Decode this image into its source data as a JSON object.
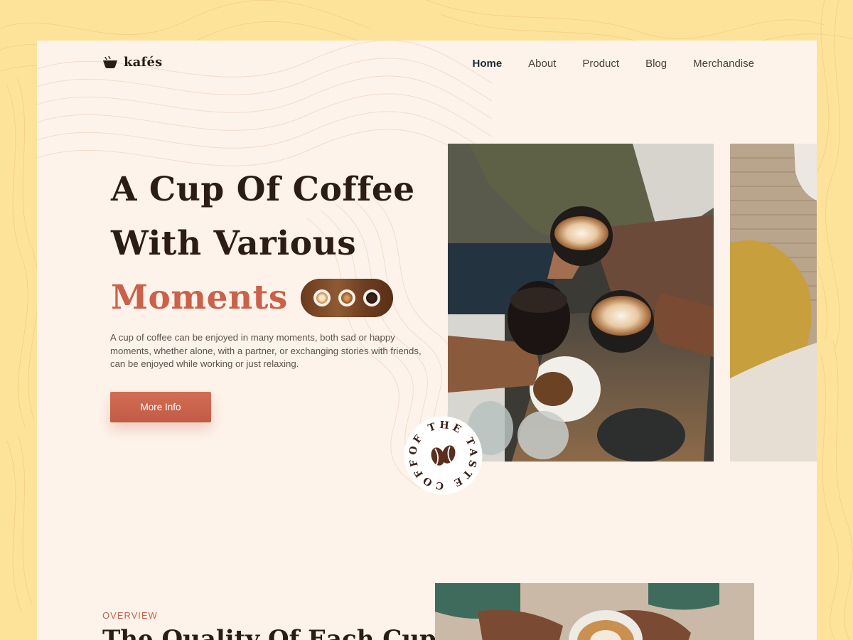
{
  "brand": {
    "name": "kafés",
    "logo_icon": "coffee-cup-icon"
  },
  "nav": {
    "items": [
      {
        "label": "Home",
        "active": true
      },
      {
        "label": "About",
        "active": false
      },
      {
        "label": "Product",
        "active": false
      },
      {
        "label": "Blog",
        "active": false
      },
      {
        "label": "Merchandise",
        "active": false
      }
    ]
  },
  "hero": {
    "line1": "A Cup Of Coffee",
    "line2": "With Various",
    "line3": "Moments",
    "description": "A cup of coffee can be enjoyed in many moments, both sad or happy moments, whether alone, with a partner, or exchanging stories with friends, can be enjoyed while working or just relaxing.",
    "button_label": "More Info"
  },
  "badge": {
    "circular_text": "OF THE TASTE COFFEE",
    "icon": "coffee-bean-icon"
  },
  "overview": {
    "label": "OVERVIEW",
    "title": "The Quality Of Each Cup"
  },
  "colors": {
    "background": "#fde39a",
    "card": "#fef3ea",
    "accent": "#c9614b",
    "heading": "#2b1d16"
  }
}
